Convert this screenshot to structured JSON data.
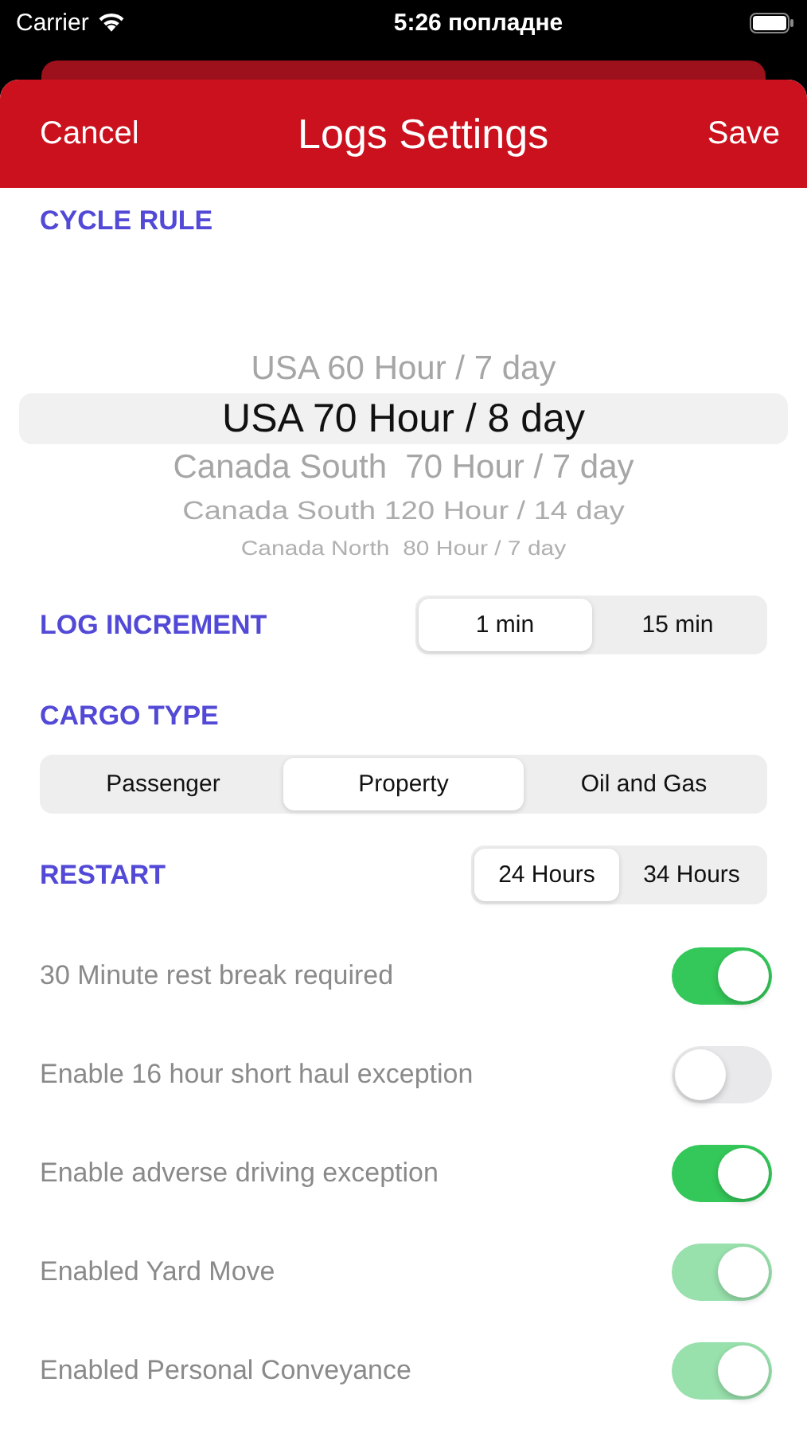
{
  "status_bar": {
    "carrier": "Carrier",
    "time": "5:26 попладне"
  },
  "nav_bar": {
    "cancel": "Cancel",
    "title": "Logs Settings",
    "save": "Save"
  },
  "cycle_rule": {
    "label": "CYCLE RULE",
    "options": [
      {
        "label": "USA 60 Hour / 7 day",
        "selected": false
      },
      {
        "label": "USA 70 Hour / 8 day",
        "selected": true
      },
      {
        "label": "Canada South  70 Hour / 7 day",
        "selected": false
      },
      {
        "label": "Canada South 120 Hour / 14 day",
        "selected": false
      },
      {
        "label": "Canada North  80 Hour / 7 day",
        "selected": false
      }
    ]
  },
  "log_increment": {
    "label": "LOG INCREMENT",
    "segments": [
      {
        "label": "1 min",
        "selected": true
      },
      {
        "label": "15 min",
        "selected": false
      }
    ]
  },
  "cargo_type": {
    "label": "CARGO TYPE",
    "segments": [
      {
        "label": "Passenger",
        "selected": false
      },
      {
        "label": "Property",
        "selected": true
      },
      {
        "label": "Oil and Gas",
        "selected": false
      }
    ]
  },
  "restart": {
    "label": "RESTART",
    "segments": [
      {
        "label": "24 Hours",
        "selected": true
      },
      {
        "label": "34 Hours",
        "selected": false
      }
    ]
  },
  "switches": [
    {
      "label": "30 Minute rest break required",
      "on": true,
      "disabled": false
    },
    {
      "label": "Enable 16 hour short haul exception",
      "on": false,
      "disabled": false
    },
    {
      "label": "Enable adverse driving exception",
      "on": true,
      "disabled": false
    },
    {
      "label": "Enabled Yard Move",
      "on": true,
      "disabled": true
    },
    {
      "label": "Enabled Personal Conveyance",
      "on": true,
      "disabled": true
    }
  ]
}
